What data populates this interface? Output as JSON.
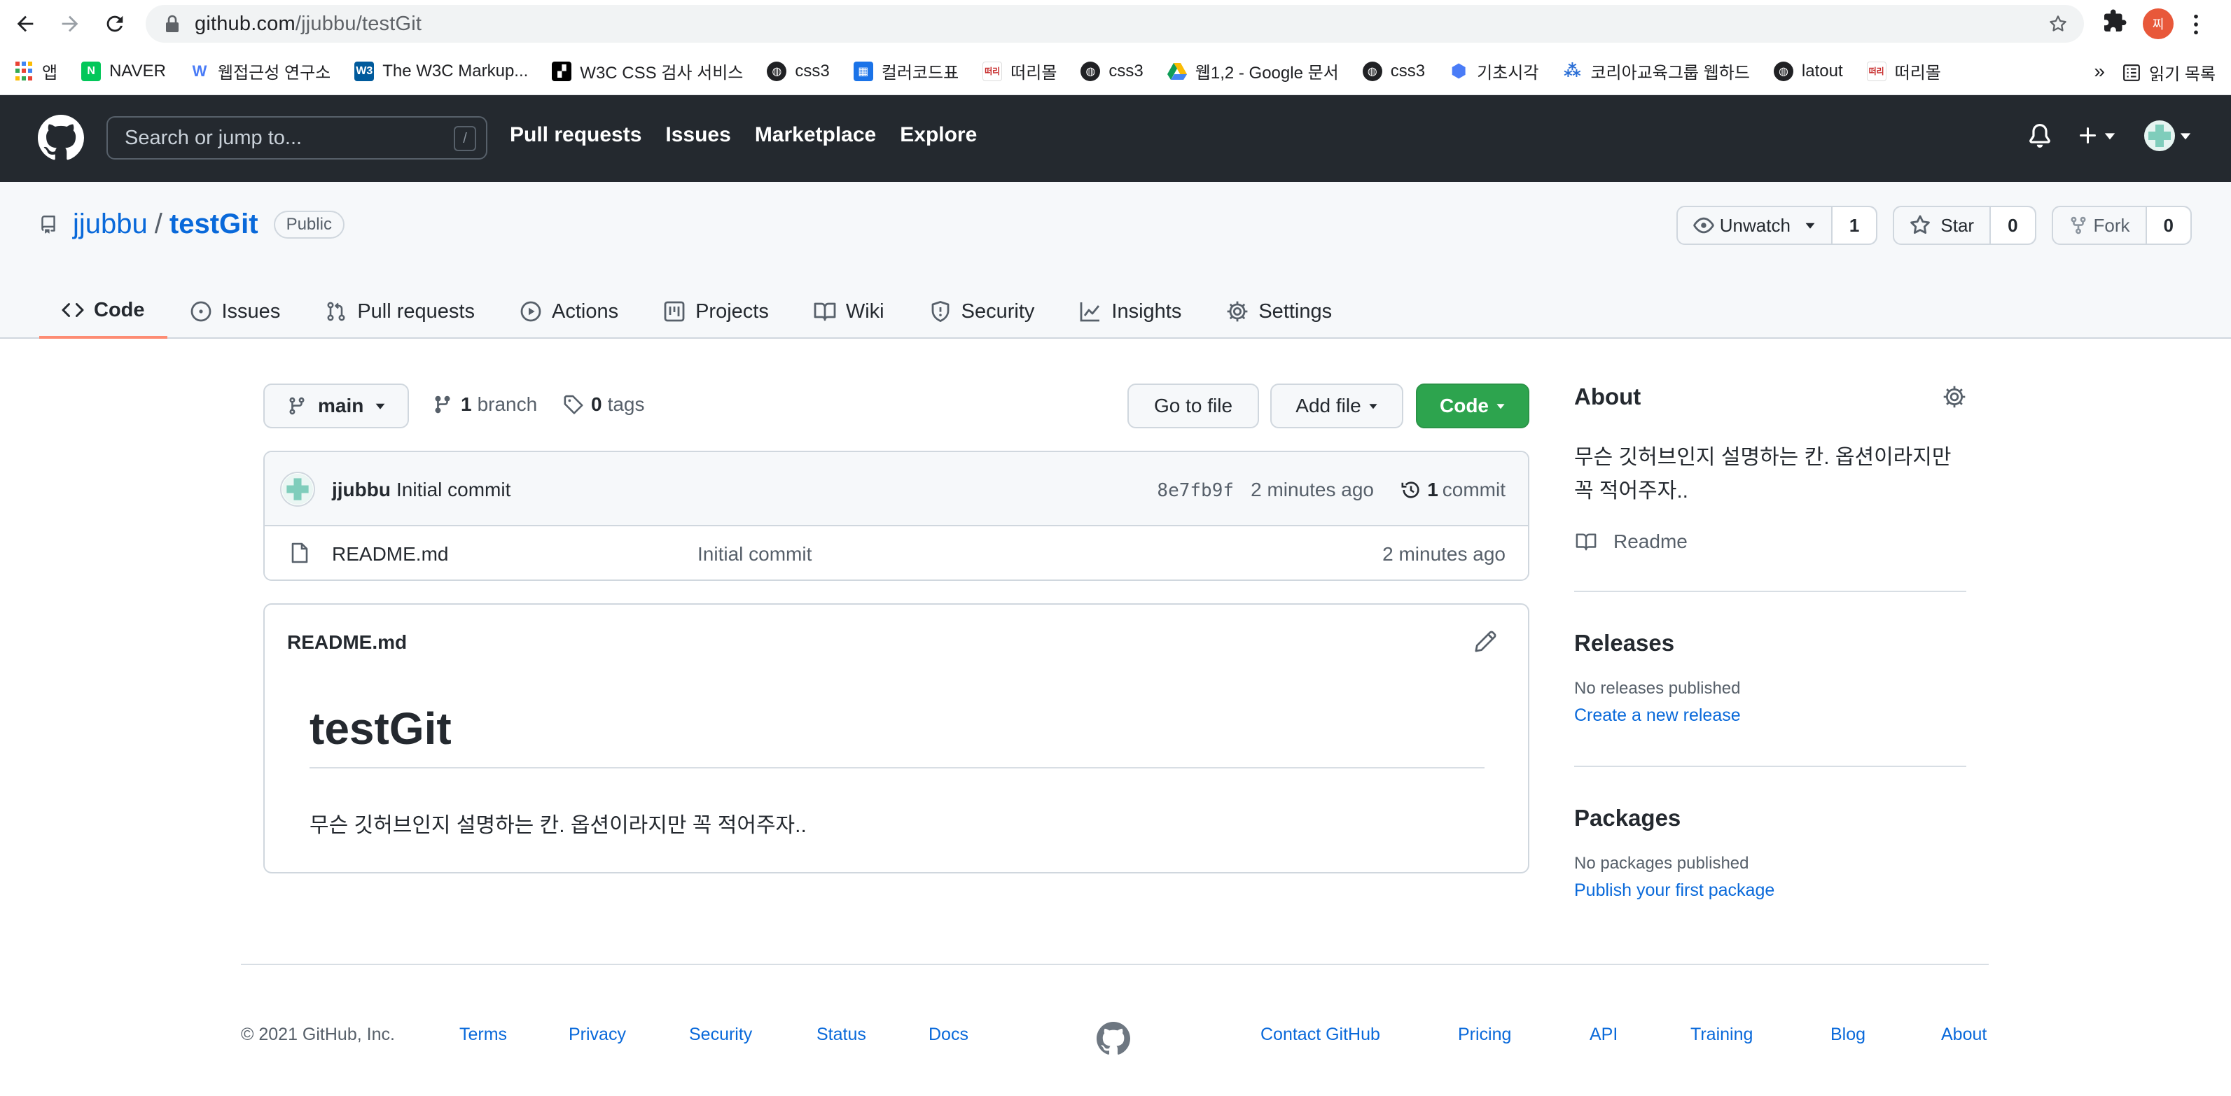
{
  "browser": {
    "url_host": "github.com",
    "url_path": "/jjubbu/testGit",
    "profile_initial": "찌",
    "bookmarks": [
      {
        "label": "앱",
        "icon": "apps-grid-icon",
        "color": "#4285f4"
      },
      {
        "label": "NAVER",
        "icon": "naver-icon",
        "color": "#03c75a"
      },
      {
        "label": "웹접근성 연구소",
        "icon": "w-logo-icon",
        "color": "#ffffff"
      },
      {
        "label": "The W3C Markup...",
        "icon": "w3-logo-icon",
        "color": "#005a9c"
      },
      {
        "label": "W3C CSS 검사 서비스",
        "icon": "w3c-css-icon",
        "color": "#000000"
      },
      {
        "label": "css3",
        "icon": "globe-icon",
        "color": "#202124"
      },
      {
        "label": "컬러코드표",
        "icon": "colorcode-icon",
        "color": "#1a73e8"
      },
      {
        "label": "떠리몰",
        "icon": "shop-icon",
        "color": "#ffffff"
      },
      {
        "label": "css3",
        "icon": "globe-icon",
        "color": "#202124"
      },
      {
        "label": "웹1,2 - Google 문서",
        "icon": "google-drive-icon",
        "color": "#0f9d58"
      },
      {
        "label": "css3",
        "icon": "globe-icon",
        "color": "#202124"
      },
      {
        "label": "기초시각",
        "icon": "hexagon-icon",
        "color": "#4a7cf7"
      },
      {
        "label": "코리아교육그룹 웹하드",
        "icon": "webhard-icon",
        "color": "#2b6fd6"
      },
      {
        "label": "latout",
        "icon": "globe-icon",
        "color": "#202124"
      },
      {
        "label": "떠리몰",
        "icon": "shop-icon",
        "color": "#ffffff"
      }
    ],
    "more_label": "»",
    "reading_list": "읽기 목록"
  },
  "gh_header": {
    "search_placeholder": "Search or jump to...",
    "search_key": "/",
    "nav": [
      "Pull requests",
      "Issues",
      "Marketplace",
      "Explore"
    ]
  },
  "repo": {
    "owner": "jjubbu",
    "sep": "/",
    "name": "testGit",
    "visibility": "Public",
    "watch_label": "Unwatch",
    "watch_count": "1",
    "star_label": "Star",
    "star_count": "0",
    "fork_label": "Fork",
    "fork_count": "0",
    "tabs": [
      "Code",
      "Issues",
      "Pull requests",
      "Actions",
      "Projects",
      "Wiki",
      "Security",
      "Insights",
      "Settings"
    ]
  },
  "toolbar": {
    "branch": "main",
    "branch_count": "1",
    "branch_word": "branch",
    "tag_count": "0",
    "tag_word": "tags",
    "goto_file": "Go to file",
    "add_file": "Add file",
    "code": "Code"
  },
  "commit": {
    "author": "jjubbu",
    "message": "Initial commit",
    "sha": "8e7fb9f",
    "time": "2 minutes ago",
    "count": "1",
    "count_word": "commit"
  },
  "files": [
    {
      "name": "README.md",
      "commit": "Initial commit",
      "time": "2 minutes ago"
    }
  ],
  "readme": {
    "label": "README.md",
    "title": "testGit",
    "body": "무슨 깃허브인지 설명하는 칸. 옵션이라지만 꼭 적어주자.."
  },
  "sidebar": {
    "about_title": "About",
    "about_text": "무슨 깃허브인지 설명하는 칸. 옵션이라지만 꼭 적어주자..",
    "readme_link": "Readme",
    "releases_title": "Releases",
    "releases_none": "No releases published",
    "releases_link": "Create a new release",
    "packages_title": "Packages",
    "packages_none": "No packages published",
    "packages_link": "Publish your first package"
  },
  "footer": {
    "copyright": "© 2021 GitHub, Inc.",
    "left_links": [
      "Terms",
      "Privacy",
      "Security",
      "Status",
      "Docs"
    ],
    "right_links": [
      "Contact GitHub",
      "Pricing",
      "API",
      "Training",
      "Blog",
      "About"
    ]
  },
  "colors": {
    "header_bg": "#24292f",
    "link": "#0969da",
    "code_button": "#2da44e",
    "active_tab_underline": "#fd8c73"
  }
}
